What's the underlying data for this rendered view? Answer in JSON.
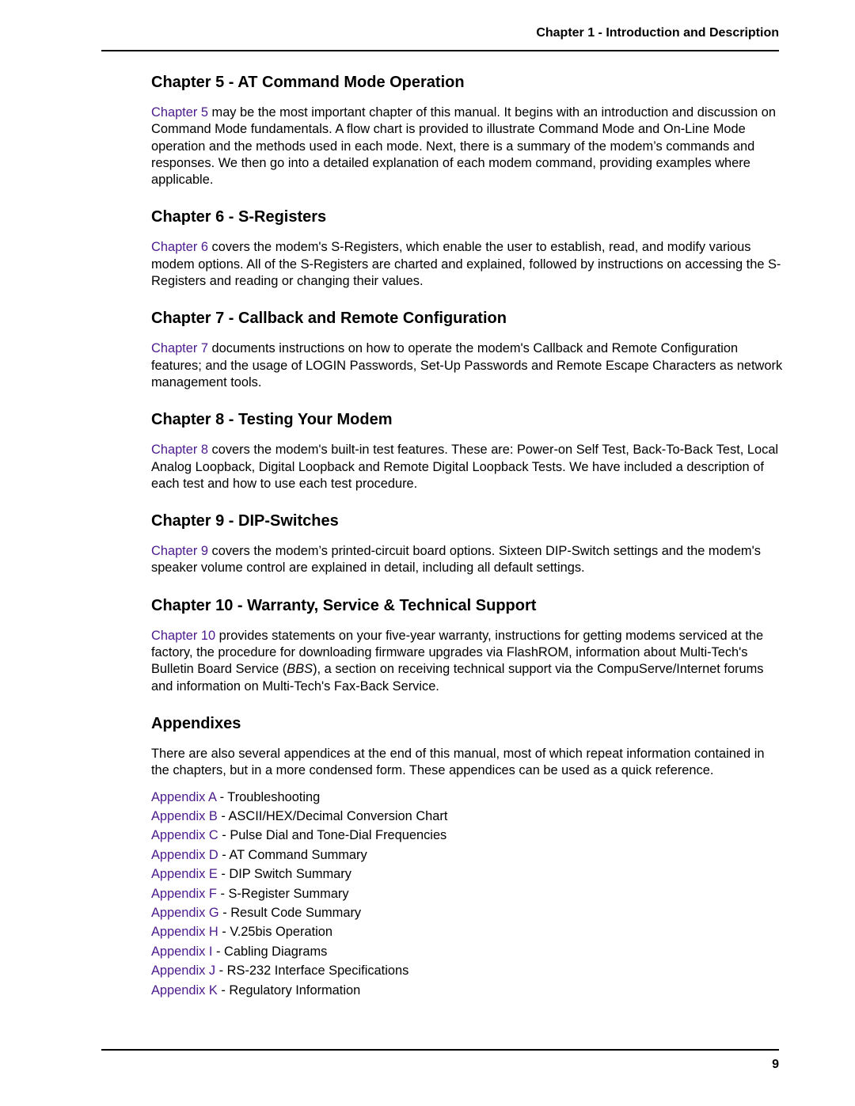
{
  "header": {
    "running_title": "Chapter 1 - Introduction and Description"
  },
  "sections": [
    {
      "heading": "Chapter 5 - AT Command Mode Operation",
      "link": "Chapter 5",
      "text": " may be the most important chapter of this manual. It begins with an introduction and discussion on Command Mode fundamentals. A flow chart is provided to illustrate Command Mode and On-Line Mode operation and the methods used in each mode. Next, there is a summary of the modem’s commands and responses. We then go into a detailed explanation of each modem command, providing examples where applicable."
    },
    {
      "heading": "Chapter 6 - S-Registers",
      "link": "Chapter 6",
      "text": " covers the modem's S-Registers, which enable the user to establish, read, and modify various modem options. All of the S-Registers are charted and explained, followed by instructions on accessing the S-Registers and reading or changing their values."
    },
    {
      "heading": "Chapter 7 - Callback and Remote Configuration",
      "link": "Chapter 7",
      "text": " documents instructions on how to operate the modem's Callback and Remote Configuration features; and the usage of LOGIN Passwords, Set-Up Passwords and Remote Escape Characters as network management tools."
    },
    {
      "heading": "Chapter 8 - Testing Your Modem",
      "link": "Chapter 8",
      "text": " covers the modem's built-in test features. These are: Power-on Self Test, Back-To-Back Test, Local Analog Loopback, Digital Loopback and Remote Digital Loopback Tests. We have included a description of each test and how to use each test procedure."
    },
    {
      "heading": "Chapter 9 - DIP-Switches",
      "link": "Chapter 9",
      "text": " covers the modem’s printed-circuit board options. Sixteen DIP-Switch settings and the modem's speaker volume control are explained in detail, including all default settings."
    },
    {
      "heading": "Chapter 10 - Warranty, Service & Technical Support",
      "link": "Chapter 10",
      "text_before_em": " provides statements on your five-year warranty, instructions for getting modems serviced at the factory, the procedure for downloading firmware upgrades via FlashROM, information about Multi-Tech's Bulletin Board Service (",
      "em": "BBS",
      "text_after_em": "), a section on receiving technical support via the CompuServe/Internet forums and information on Multi-Tech's Fax-Back Service."
    }
  ],
  "appendixes": {
    "heading": "Appendixes",
    "intro": "There are also several appendices at the end of this manual, most of which repeat information contained in the chapters, but in a more condensed form. These appendices can be used as a quick reference.",
    "items": [
      {
        "link": "Appendix A",
        "title": " - Troubleshooting"
      },
      {
        "link": "Appendix B",
        "title": " - ASCII/HEX/Decimal Conversion Chart"
      },
      {
        "link": "Appendix C",
        "title": " - Pulse Dial and Tone-Dial Frequencies"
      },
      {
        "link": "Appendix D",
        "title": " - AT Command Summary"
      },
      {
        "link": "Appendix E",
        "title": " - DIP Switch Summary"
      },
      {
        "link": "Appendix F",
        "title": " - S-Register Summary"
      },
      {
        "link": "Appendix G",
        "title": " - Result Code Summary"
      },
      {
        "link": "Appendix H",
        "title": " - V.25bis Operation"
      },
      {
        "link": "Appendix I",
        "title": " - Cabling Diagrams"
      },
      {
        "link": "Appendix J",
        "title": " - RS-232 Interface Specifications"
      },
      {
        "link": "Appendix K",
        "title": " - Regulatory Information"
      }
    ]
  },
  "footer": {
    "page_number": "9"
  },
  "colors": {
    "link": "#4b1a8c",
    "text": "#000000"
  }
}
